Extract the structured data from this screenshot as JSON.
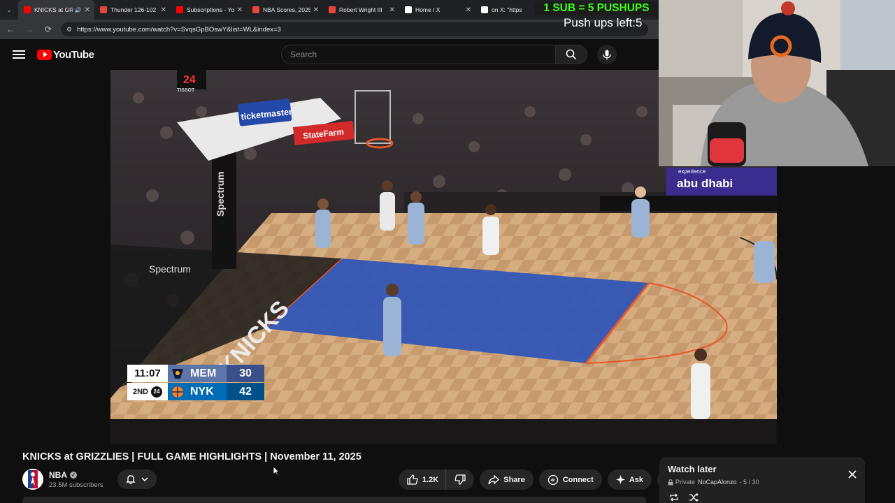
{
  "browser": {
    "tabs": [
      {
        "title": "KNICKS at GRIZZLIES",
        "favicon_color": "#ff0000",
        "active": true,
        "audio": true
      },
      {
        "title": "Thunder 126-102",
        "favicon_color": "#e8453c",
        "active": false
      },
      {
        "title": "Subscriptions - YouTube",
        "favicon_color": "#ff0000",
        "active": false
      },
      {
        "title": "NBA Scores, 2025",
        "favicon_color": "#e8453c",
        "active": false
      },
      {
        "title": "Robert Wright III",
        "favicon_color": "#e8453c",
        "active": false
      },
      {
        "title": "Home / X",
        "favicon_color": "#ffffff",
        "active": false
      },
      {
        "title": "on X: \"https",
        "favicon_color": "#ffffff",
        "active": false
      }
    ],
    "url": "https://www.youtube.com/watch?v=SvqsGpBOswY&list=WL&index=3"
  },
  "youtube": {
    "logo_text": "YouTube",
    "search_placeholder": "Search"
  },
  "stream_overlay": {
    "banner": "1 SUB = 5 PUSHUPS",
    "pushups_left": "Push ups left:5"
  },
  "scoreboard": {
    "clock": "11:07",
    "period": "2ND",
    "shot_clock": "24",
    "away": {
      "abbr": "MEM",
      "score": "30",
      "color": "#5d76a9"
    },
    "home": {
      "abbr": "NYK",
      "score": "42",
      "color": "#006bb6"
    }
  },
  "arena_signs": {
    "ticketmaster": "ticketmaster",
    "statefarm": "StateFarm",
    "spectrum": "Spectrum",
    "knicks": "KNICKS",
    "abudhabi": "abu dhabi",
    "experience": "experience",
    "shot_clock_display": "24",
    "tissot": "TISSOT"
  },
  "video": {
    "title": "KNICKS at GRIZZLIES | FULL GAME HIGHLIGHTS | November 11, 2025"
  },
  "channel": {
    "name": "NBA",
    "subscribers": "23.5M subscribers"
  },
  "actions": {
    "likes": "1.2K",
    "share": "Share",
    "connect": "Connect",
    "ask": "Ask"
  },
  "watch_later": {
    "title": "Watch later",
    "privacy": "Private",
    "owner": "NoCapAlonzo",
    "position": "- 5 / 30"
  }
}
